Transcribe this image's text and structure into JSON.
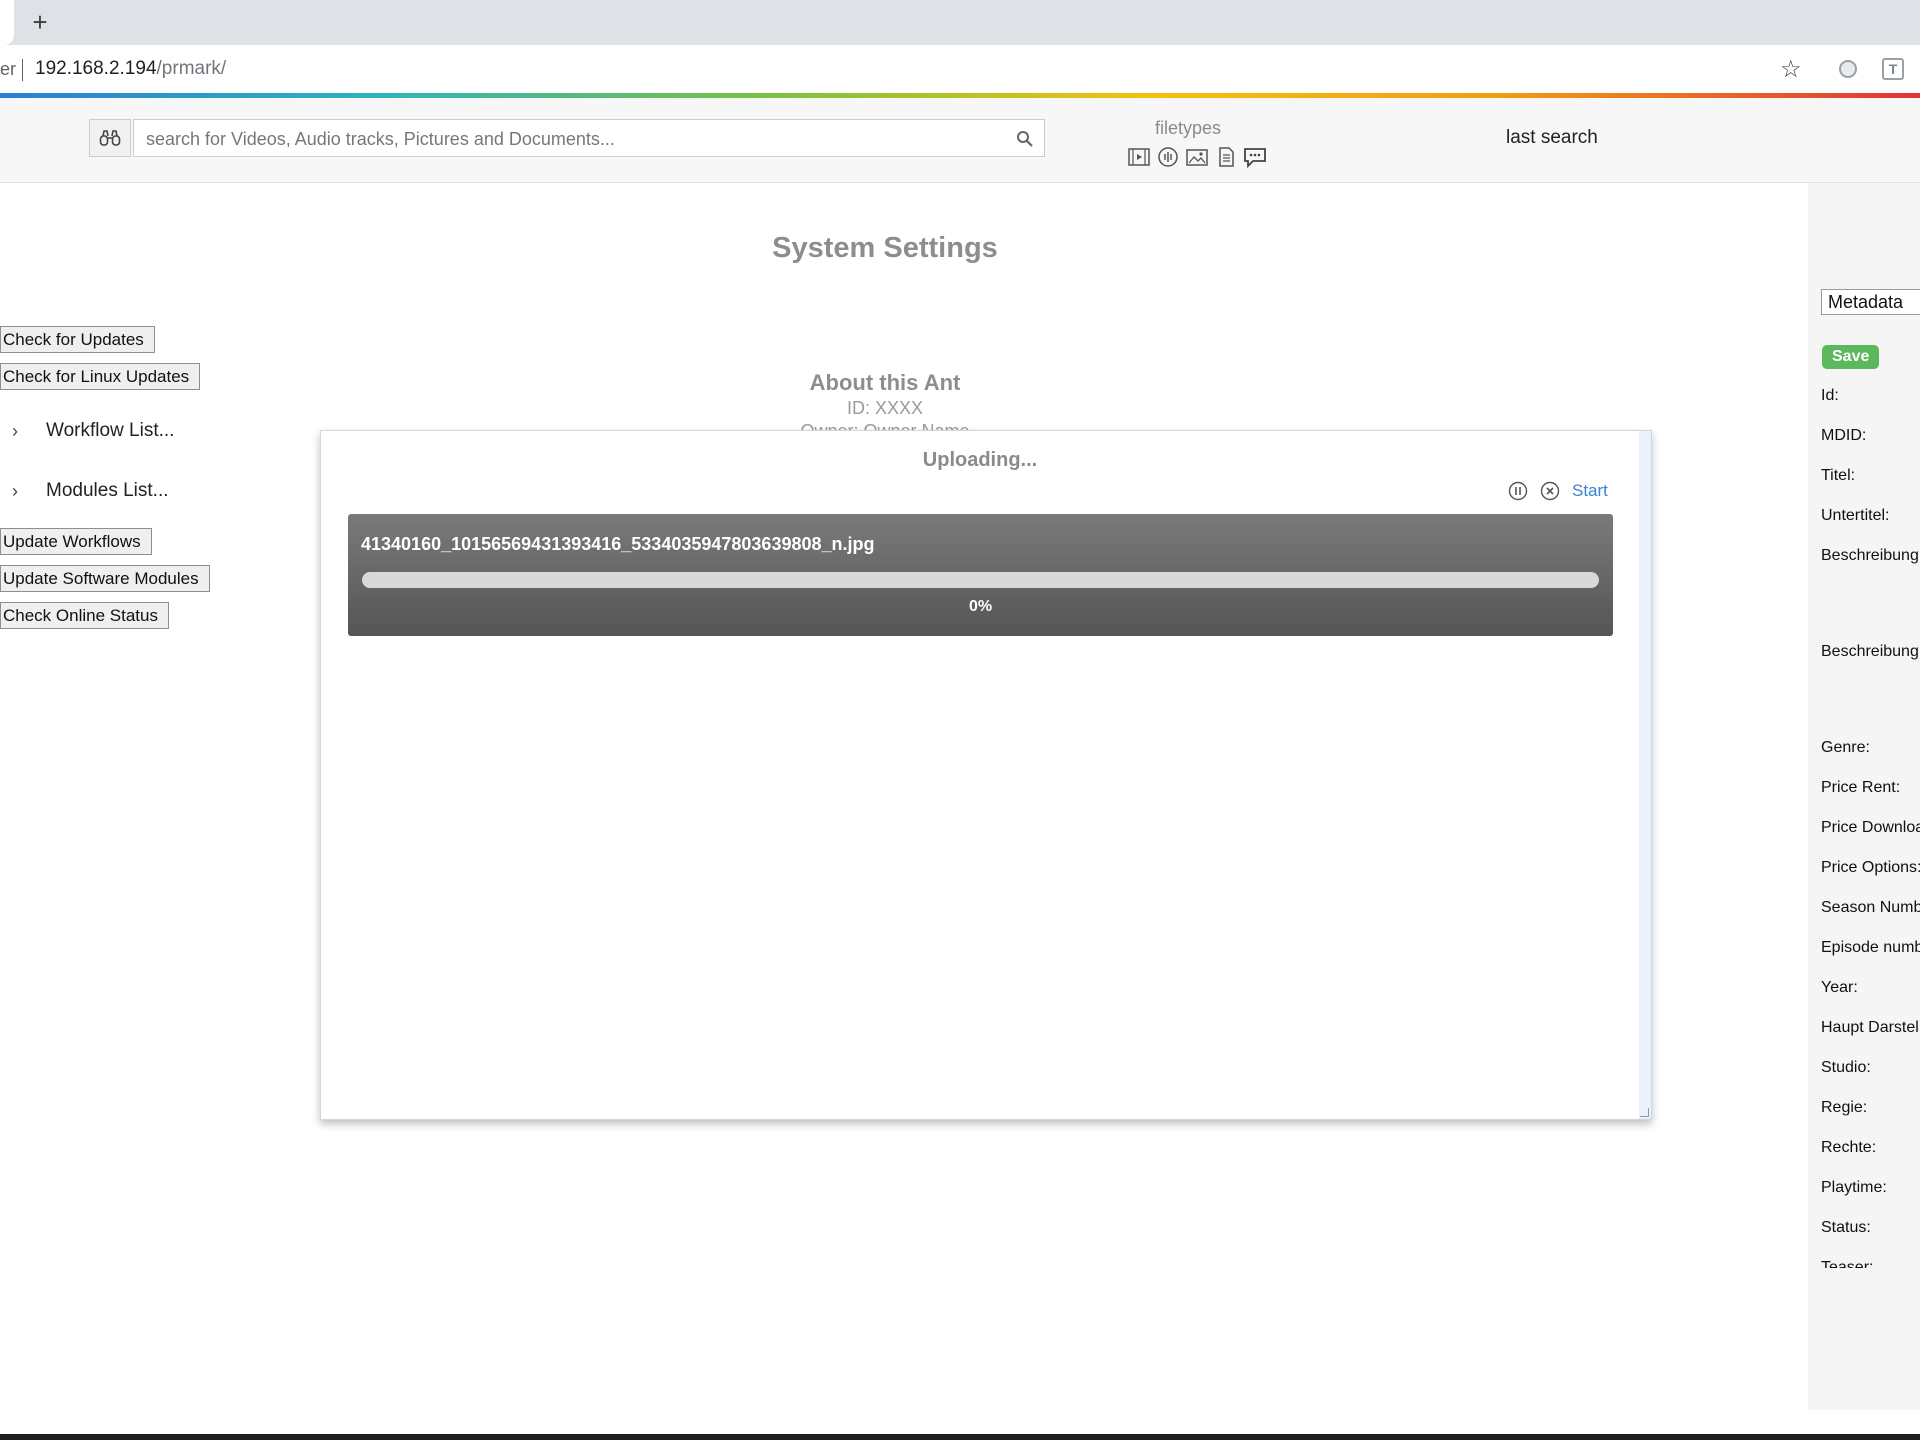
{
  "browser": {
    "new_tab_label": "+",
    "url_fragment": "er",
    "url_host": "192.168.2.194",
    "url_path": "/prmark/",
    "ext_label": "T"
  },
  "header": {
    "search_placeholder": "search for Videos, Audio tracks, Pictures and Documents...",
    "filetypes_label": "filetypes",
    "filetype_icons": [
      "video-icon",
      "audio-icon",
      "image-icon",
      "document-icon",
      "comment-icon"
    ],
    "last_search_label": "last search"
  },
  "settings": {
    "title": "System Settings",
    "check_updates": "Check for Updates",
    "check_linux_updates": "Check for Linux Updates",
    "workflow_list": "Workflow List...",
    "modules_list": "Modules List...",
    "update_workflows": "Update Workflows",
    "update_software_modules": "Update Software Modules",
    "check_online_status": "Check Online Status",
    "about_title": "About this Ant",
    "about_id": "ID: XXXX",
    "about_owner": "Owner: Owner Name"
  },
  "upload_dialog": {
    "title": "Uploading...",
    "start_label": "Start",
    "file_name": "41340160_10156569431393416_5334035947803639808_n.jpg",
    "progress_label": "0%",
    "progress_value": 0
  },
  "metadata_panel": {
    "select_value": "Metadata",
    "save_label": "Save",
    "labels": [
      "Id:",
      "MDID:",
      "Titel:",
      "Untertitel:",
      "Beschreibung",
      "Beschreibung",
      "Genre:",
      "Price Rent:",
      "Price Downloa",
      "Price Options:",
      "Season Numb",
      "Episode numb",
      "Year:",
      "Haupt Darstel",
      "Studio:",
      "Regie:",
      "Rechte:",
      "Playtime:",
      "Status:",
      "Teaser:"
    ]
  },
  "colors": {
    "accent_blue": "#3b82d6",
    "save_green": "#5cb85c",
    "title_gray": "#8d8d8d"
  }
}
